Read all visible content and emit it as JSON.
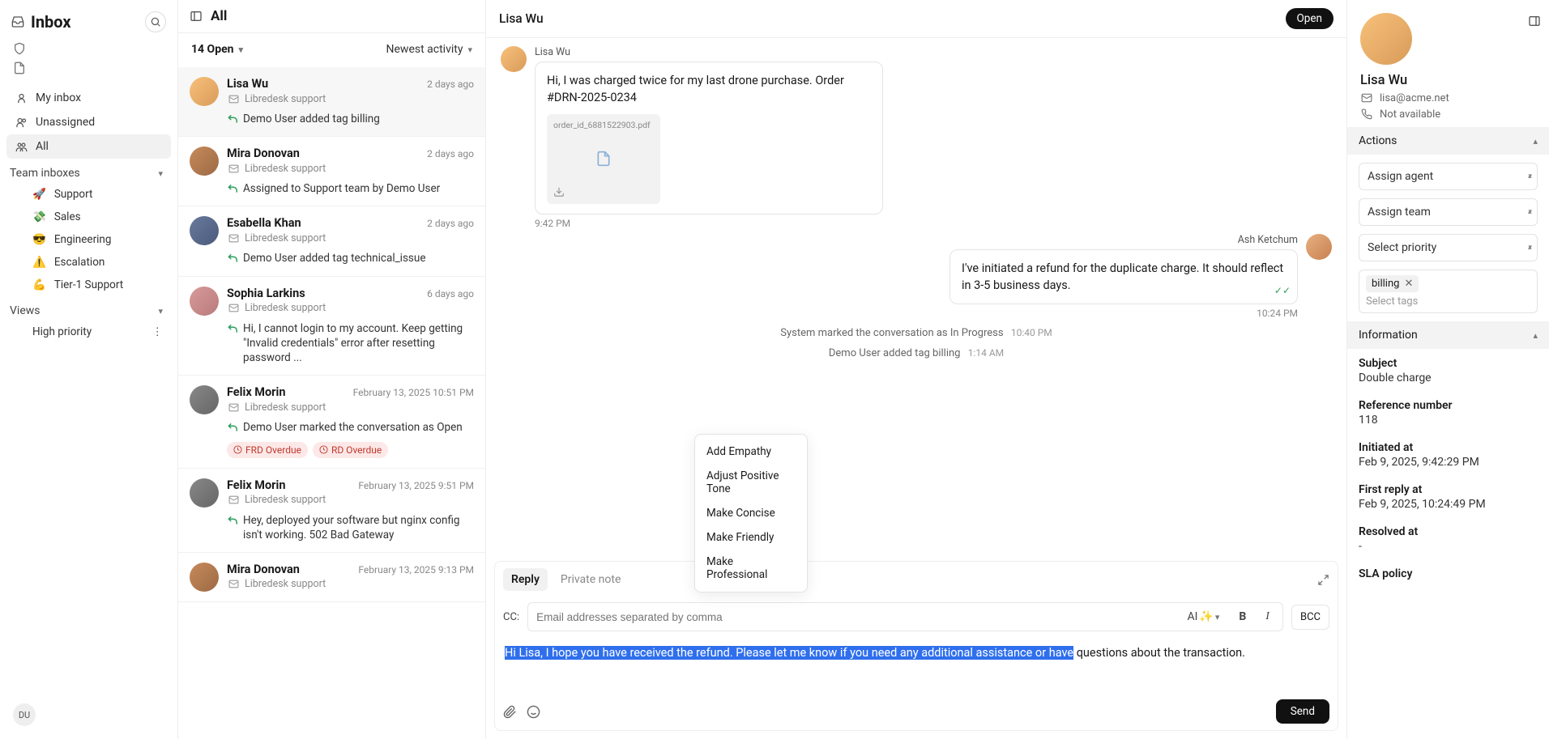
{
  "nav": {
    "title": "Inbox",
    "items": {
      "my_inbox": "My inbox",
      "unassigned": "Unassigned",
      "all": "All"
    },
    "team_section": "Team inboxes",
    "teams": [
      {
        "icon": "🚀",
        "label": "Support"
      },
      {
        "icon": "💸",
        "label": "Sales"
      },
      {
        "icon": "😎",
        "label": "Engineering"
      },
      {
        "icon": "⚠️",
        "label": "Escalation"
      },
      {
        "icon": "💪",
        "label": "Tier-1 Support"
      }
    ],
    "views_section": "Views",
    "views": [
      {
        "label": "High priority"
      }
    ],
    "user_initials": "DU"
  },
  "list": {
    "title": "All",
    "filter_count": "14 Open",
    "sort": "Newest activity",
    "items": [
      {
        "name": "Lisa Wu",
        "time": "2 days ago",
        "source": "Libredesk support",
        "preview": "Demo User added tag billing",
        "selected": true
      },
      {
        "name": "Mira Donovan",
        "time": "2 days ago",
        "source": "Libredesk support",
        "preview": "Assigned to Support team by Demo User"
      },
      {
        "name": "Esabella Khan",
        "time": "2 days ago",
        "source": "Libredesk support",
        "preview": "Demo User added tag technical_issue"
      },
      {
        "name": "Sophia Larkins",
        "time": "6 days ago",
        "source": "Libredesk support",
        "preview": "Hi, I cannot login to my account. Keep getting \"Invalid credentials\" error after resetting password ..."
      },
      {
        "name": "Felix Morin",
        "time": "February 13, 2025 10:51 PM",
        "source": "Libredesk support",
        "preview": "Demo User marked the conversation as Open",
        "badges": [
          "FRD Overdue",
          "RD Overdue"
        ]
      },
      {
        "name": "Felix Morin",
        "time": "February 13, 2025 9:51 PM",
        "source": "Libredesk support",
        "preview": "Hey, deployed your software but nginx config isn't working. 502 Bad Gateway"
      },
      {
        "name": "Mira Donovan",
        "time": "February 13, 2025 9:13 PM",
        "source": "Libredesk support",
        "preview": ""
      }
    ]
  },
  "conversation": {
    "title": "Lisa Wu",
    "status_btn": "Open",
    "msg_in": {
      "sender": "Lisa Wu",
      "body": "Hi, I was charged twice for my last drone purchase. Order #DRN-2025-0234",
      "attach": "order_id_6881522903.pdf",
      "time": "9:42 PM"
    },
    "msg_out": {
      "sender": "Ash Ketchum",
      "body": "I've initiated a refund for the duplicate charge. It should reflect in 3-5 business days.",
      "time": "10:24 PM"
    },
    "sys1": {
      "text": "System marked the conversation as In Progress",
      "time": "10:40 PM"
    },
    "sys2": {
      "text": "Demo User added tag billing",
      "time": "1:14 AM"
    }
  },
  "composer": {
    "tab_reply": "Reply",
    "tab_note": "Private note",
    "cc_label": "CC:",
    "cc_placeholder": "Email addresses separated by comma",
    "ai_label": "AI",
    "bcc": "BCC",
    "draft_hl": "Hi Lisa, I hope you have received the refund. Please let me know if you need any additional assistance or have",
    "draft_rest": " questions about the transaction.",
    "send": "Send",
    "ai_menu": [
      "Add Empathy",
      "Adjust Positive Tone",
      "Make Concise",
      "Make Friendly",
      "Make Professional"
    ]
  },
  "details": {
    "name": "Lisa Wu",
    "email": "lisa@acme.net",
    "phone": "Not available",
    "actions_title": "Actions",
    "assign_agent": "Assign agent",
    "assign_team": "Assign team",
    "select_priority": "Select priority",
    "tag": "billing",
    "tag_placeholder": "Select tags",
    "info_title": "Information",
    "subject_l": "Subject",
    "subject_v": "Double charge",
    "ref_l": "Reference number",
    "ref_v": "118",
    "init_l": "Initiated at",
    "init_v": "Feb 9, 2025, 9:42:29 PM",
    "first_l": "First reply at",
    "first_v": "Feb 9, 2025, 10:24:49 PM",
    "res_l": "Resolved at",
    "res_v": "-",
    "sla_l": "SLA policy"
  }
}
